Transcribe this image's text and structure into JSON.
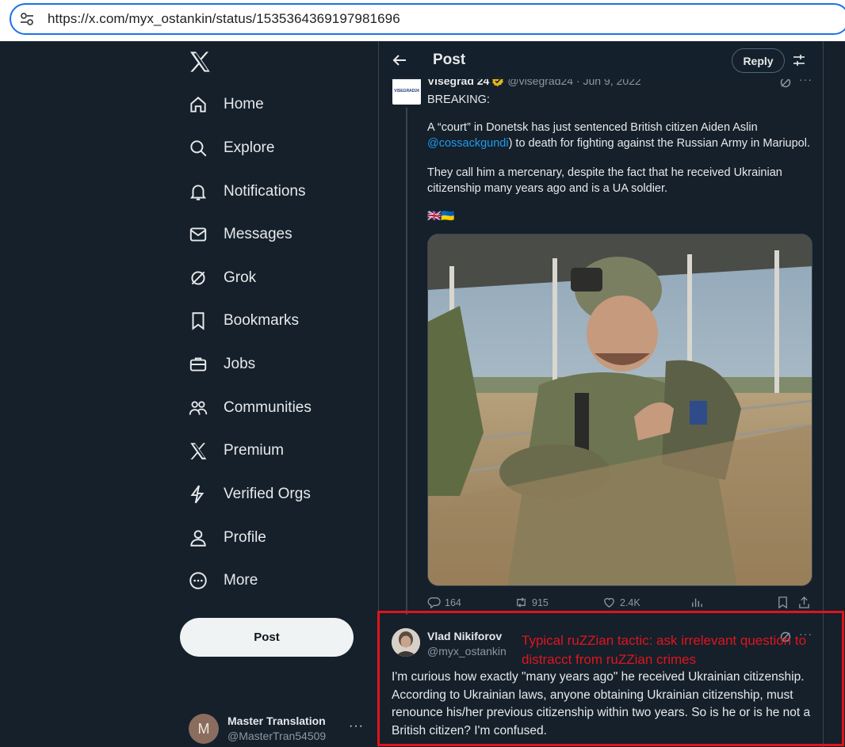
{
  "browser": {
    "url": "https://x.com/myx_ostankin/status/1535364369197981696"
  },
  "nav": {
    "items": [
      {
        "label": "Home",
        "icon": "home-icon"
      },
      {
        "label": "Explore",
        "icon": "search-icon"
      },
      {
        "label": "Notifications",
        "icon": "bell-icon"
      },
      {
        "label": "Messages",
        "icon": "mail-icon"
      },
      {
        "label": "Grok",
        "icon": "grok-icon"
      },
      {
        "label": "Bookmarks",
        "icon": "bookmark-icon"
      },
      {
        "label": "Jobs",
        "icon": "briefcase-icon"
      },
      {
        "label": "Communities",
        "icon": "people-icon"
      },
      {
        "label": "Premium",
        "icon": "x-logo-icon"
      },
      {
        "label": "Verified Orgs",
        "icon": "lightning-icon"
      },
      {
        "label": "Profile",
        "icon": "person-icon"
      },
      {
        "label": "More",
        "icon": "more-circle-icon"
      }
    ],
    "post_button": "Post"
  },
  "account": {
    "avatar_letter": "M",
    "name": "Master Translation",
    "handle": "@MasterTran54509",
    "more": "···"
  },
  "header": {
    "title": "Post",
    "reply_button": "Reply"
  },
  "parent_post": {
    "author": "Visegrad 24",
    "avatar_text": "VISEGRAD24",
    "meta": "@visegrad24 · Jun 9, 2022",
    "more": "···",
    "text_breaking": "BREAKING:",
    "text_p1_a": "A “court” in Donetsk has just sentenced British citizen Aiden Aslin",
    "text_p1_mention": "@cossackgundi",
    "text_p1_b": ") to death for fighting against the Russian Army in Mariupol.",
    "text_p2": "They call him a mercenary, despite the fact that he received Ukrainian citizenship many years ago and is a UA soldier.",
    "flags": "🇬🇧🇺🇦",
    "stats": {
      "replies": "164",
      "reposts": "915",
      "likes": "2.4K"
    }
  },
  "reply_post": {
    "author": "Vlad Nikiforov",
    "handle": "@myx_ostankin",
    "more": "···",
    "text": "I'm curious how exactly \"many years ago\" he received Ukrainian citizenship. According to Ukrainian laws, anyone obtaining Ukrainian citizenship, must renounce his/her previous citizenship within two years. So is he or is he not a British citizen? I'm confused."
  },
  "annotation": {
    "text": "Typical ruZZian tactic: ask irrelevant question to distracct from ruZZian crimes",
    "color": "#e1141c"
  },
  "colors": {
    "background": "#15202b",
    "border": "#38444d",
    "secondary_text": "#8b98a5",
    "link": "#1d9bf0",
    "gold_badge": "#e2b719"
  }
}
